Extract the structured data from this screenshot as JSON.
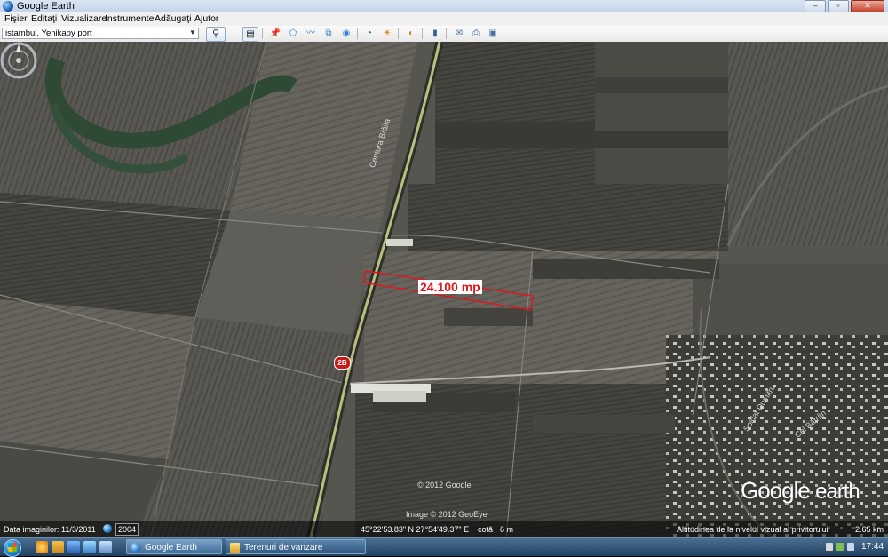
{
  "window": {
    "title": "Google Earth",
    "buttons": {
      "minimize": "–",
      "maximize": "▫",
      "close": "✕"
    }
  },
  "menu": [
    "Fişier",
    "Editaţi",
    "Vizualizare",
    "Instrumente",
    "Adăugaţi",
    "Ajutor"
  ],
  "search": {
    "value": "istambul, Yenikapy port",
    "button_icon": "magnifier-icon"
  },
  "map": {
    "area_label": "24.100 mp",
    "route_shield": "2B",
    "road_name": "Centura Brăila",
    "village_street_1": "Soldat Dumitru",
    "village_street_2": "Cel Bătrân",
    "copyright_center": "© 2012 Google",
    "copyright_image": "Image © 2012 GeoEye",
    "logo_brand": "Google",
    "logo_product": "earth"
  },
  "status": {
    "imagery_date": "Data imaginilor: 11/3/2011",
    "year": "2004",
    "coordinates": "45°22'53.83\" N  27°54'49.37\" E",
    "elevation_label": "cotă",
    "elevation_value": "6 m",
    "eye_altitude": "Altitudinea de la nivelul vizual al privitorului",
    "eye_altitude_value": "2.65 km"
  },
  "taskbar": {
    "tasks": [
      "Google Earth",
      "Terenuri de vanzare"
    ],
    "clock": "17:44"
  }
}
